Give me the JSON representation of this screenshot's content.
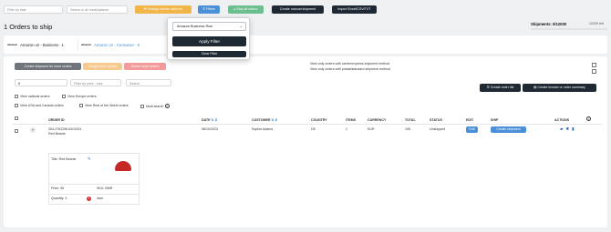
{
  "top_bar": {
    "filter_date_placeholder": "Filter by date",
    "search_marketplaces_placeholder": "Search in all marketplaces",
    "change_sender_label": "Change sender address",
    "filters_label": "Filters",
    "ship_all_label": "Ship all orders",
    "create_manual_label": "Create manual shipment",
    "import_label": "Import Excel/CSV/TXT"
  },
  "filter_dropdown": {
    "select_value": "Amazon Business Rule",
    "apply_label": "Apply Filter",
    "clear_label": "Clear Filter"
  },
  "page": {
    "title": "1 Orders to ship",
    "shipments_label": "Shipments: 0/12000",
    "shipments_total": "12000 left",
    "shipments_progress": 0.0
  },
  "marketplaces": [
    {
      "logo": "amazon",
      "name": "Amazon v2 - Business - 1"
    },
    {
      "logo": "amazon",
      "name": "Amazon v2 - Consumer - 0"
    }
  ],
  "actions_row": {
    "create_marketplace": "Create shipment for more orders",
    "merge": "Merge more orders",
    "delete": "Delete more orders",
    "opt_express": "View only orders with carrier/express shipment method",
    "opt_standard": "View only orders with postal/standard shipment method"
  },
  "filters_row": {
    "count_value": "8",
    "price_placeholder": "Filter by price - max",
    "search_placeholder": "Search",
    "create_order_list": "Create order list",
    "create_invoice": "Create invoice or order summary"
  },
  "view_options": {
    "national": "View national orders",
    "europe": "View Europe orders",
    "usa": "View USA and Canada orders",
    "rest": "View Rest of the World orders",
    "multi": "Multi search"
  },
  "table": {
    "headers": {
      "order_id": "ORDER ID",
      "date": "DATE",
      "customer": "CUSTOMER",
      "country": "COUNTRY",
      "items": "ITEMS",
      "currency": "CURRENCY",
      "total": "TOTAL",
      "status": "STATUS",
      "edit": "EDIT",
      "ship": "SHIP",
      "actions": "ACTIONS"
    },
    "row": {
      "order_id": "304-4761296-8101931",
      "product": "Red Beanie",
      "date": "08/10/2023",
      "customer": "Sophia Adams",
      "country": "DE",
      "items": "1",
      "currency": "EUR",
      "total": "195",
      "status": "Unshipped",
      "edit_label": "Edit",
      "ship_label": "Create shipment"
    }
  },
  "product_card": {
    "title_label": "Title: Red Beanie",
    "price": "Price: 55",
    "sku": "SKU: BMR",
    "quantity": "Quantity: 3",
    "quantity_badge": "1",
    "size": "4am"
  }
}
